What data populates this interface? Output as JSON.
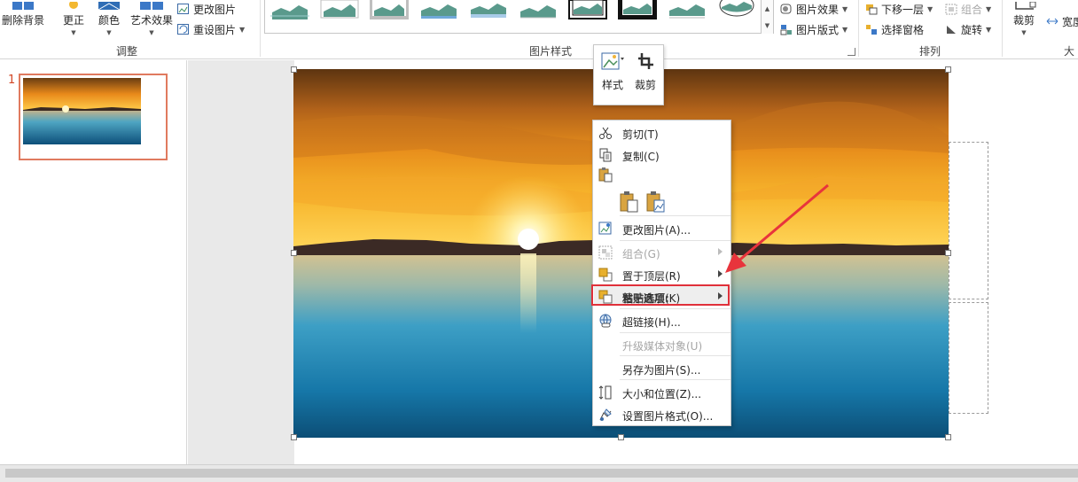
{
  "ribbon": {
    "remove_background": "删除背景",
    "corrections": "更正",
    "color": "颜色",
    "artistic_effects": "艺术效果",
    "change_picture": "更改图片",
    "reset_picture": "重设图片",
    "adjust_group": "调整",
    "picture_styles_group": "图片样式",
    "picture_effects": "图片效果",
    "picture_layout": "图片版式",
    "send_backward": "下移一层",
    "selection_pane": "选择窗格",
    "group": "组合",
    "rotate": "旋转",
    "arrange_group": "排列",
    "crop": "裁剪",
    "width_partial": "宽度",
    "size_partial": "大小"
  },
  "thumbnails": {
    "slide_number": "1"
  },
  "mini_toolbar": {
    "style": "样式",
    "crop": "裁剪"
  },
  "context_menu": {
    "items": [
      {
        "label": "剪切(T)",
        "enabled": true
      },
      {
        "label": "复制(C)",
        "enabled": true
      },
      {
        "label": "粘贴选项:",
        "enabled": true
      },
      {
        "label": "更改图片(A)...",
        "enabled": true
      },
      {
        "label": "组合(G)",
        "enabled": false
      },
      {
        "label": "置于顶层(R)",
        "enabled": true
      },
      {
        "label": "置于底层(K)",
        "enabled": true
      },
      {
        "label": "超链接(H)...",
        "enabled": true
      },
      {
        "label": "升级媒体对象(U)",
        "enabled": false
      },
      {
        "label": "另存为图片(S)...",
        "enabled": true
      },
      {
        "label": "大小和位置(Z)...",
        "enabled": true
      },
      {
        "label": "设置图片格式(O)...",
        "enabled": true
      }
    ]
  },
  "colors": {
    "highlight": "#e0303a",
    "arrow": "#e8343c",
    "thumbnail_border": "#e07a5f",
    "slide_number": "#d24726"
  }
}
